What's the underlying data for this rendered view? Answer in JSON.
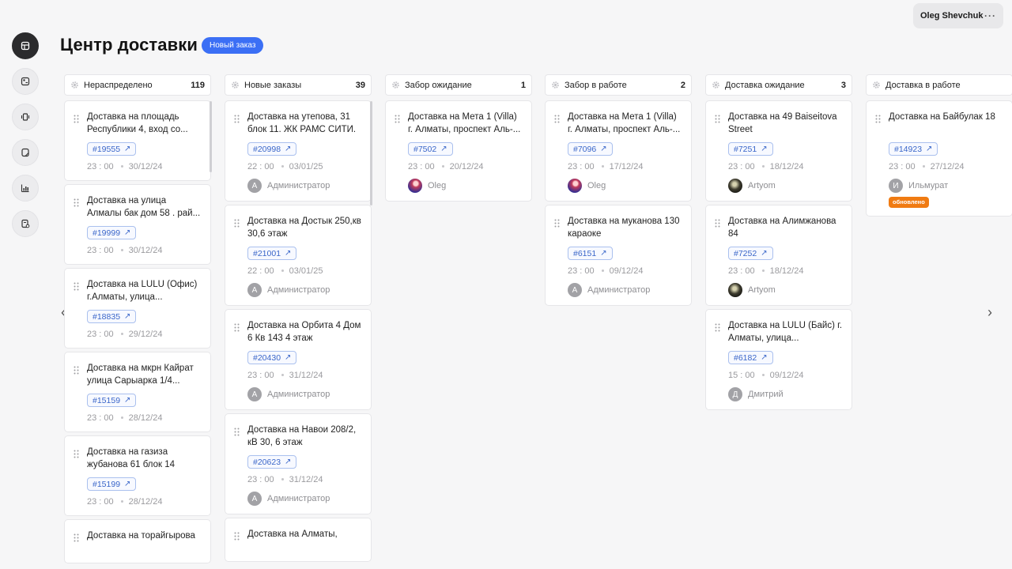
{
  "header": {
    "title": "Центр доставки",
    "new_order_label": "Новый заказ",
    "user_name": "Oleg Shevchuk",
    "user_menu": "···"
  },
  "nav": {
    "left": "‹",
    "right": "›"
  },
  "columns": [
    {
      "name": "Нераспределено",
      "count": "119",
      "cards": [
        {
          "title": "Доставка на площадь Республики 4, вход со...",
          "tag": "#19555",
          "time": "23 : 00",
          "date": "30/12/24"
        },
        {
          "title": "Доставка на улица Алмалы бак дом 58 . рай...",
          "tag": "#19999",
          "time": "23 : 00",
          "date": "30/12/24"
        },
        {
          "title": "Доставка на LULU (Офис) г.Алматы, улица...",
          "tag": "#18835",
          "time": "23 : 00",
          "date": "29/12/24"
        },
        {
          "title": "Доставка на мкрн Кайрат улица Сарыарка 1/4...",
          "tag": "#15159",
          "time": "23 : 00",
          "date": "28/12/24"
        },
        {
          "title": "Доставка на газиза жубанова 61 блок 14",
          "tag": "#15199",
          "time": "23 : 00",
          "date": "28/12/24"
        },
        {
          "title": "Доставка на торайгырова",
          "tag": "",
          "time": "",
          "date": ""
        }
      ]
    },
    {
      "name": "Новые заказы",
      "count": "39",
      "cards": [
        {
          "title": "Доставка на утепова, 31 блок 11. ЖК РАМС СИТИ. ...",
          "tag": "#20998",
          "time": "22 : 00",
          "date": "03/01/25",
          "assignee": "Администратор",
          "initial": "А"
        },
        {
          "title": "Доставка на Достык 250,кв 30,6 этаж",
          "tag": "#21001",
          "time": "22 : 00",
          "date": "03/01/25",
          "assignee": "Администратор",
          "initial": "А"
        },
        {
          "title": "Доставка на Орбита 4 Дом 6 Кв 143 4 этаж",
          "tag": "#20430",
          "time": "23 : 00",
          "date": "31/12/24",
          "assignee": "Администратор",
          "initial": "А"
        },
        {
          "title": "Доставка на Навои 208/2, кВ 30, 6 этаж",
          "tag": "#20623",
          "time": "23 : 00",
          "date": "31/12/24",
          "assignee": "Администратор",
          "initial": "А"
        },
        {
          "title": "Доставка на Алматы,",
          "tag": "",
          "time": "",
          "date": ""
        }
      ]
    },
    {
      "name": "Забор ожидание",
      "count": "1",
      "cards": [
        {
          "title": "Доставка на Мета 1 (Villa) г. Алматы, проспект Аль-...",
          "tag": "#7502",
          "time": "23 : 00",
          "date": "20/12/24",
          "assignee": "Oleg",
          "avatar": "oleg-photo"
        }
      ]
    },
    {
      "name": "Забор в работе",
      "count": "2",
      "cards": [
        {
          "title": "Доставка на Мета 1 (Villa) г. Алматы, проспект Аль-...",
          "tag": "#7096",
          "time": "23 : 00",
          "date": "17/12/24",
          "assignee": "Oleg",
          "avatar": "oleg-photo"
        },
        {
          "title": "Доставка на муканова 130 караоке",
          "tag": "#6151",
          "time": "23 : 00",
          "date": "09/12/24",
          "assignee": "Администратор",
          "initial": "А"
        }
      ]
    },
    {
      "name": "Доставка ожидание",
      "count": "3",
      "cards": [
        {
          "title": "Доставка на 49 Baiseitova Street",
          "tag": "#7251",
          "time": "23 : 00",
          "date": "18/12/24",
          "assignee": "Artyom",
          "avatar": "artyom-photo"
        },
        {
          "title": "Доставка на Алимжанова 84",
          "tag": "#7252",
          "time": "23 : 00",
          "date": "18/12/24",
          "assignee": "Artyom",
          "avatar": "artyom-photo"
        },
        {
          "title": "Доставка на LULU (Байс) г. Алматы, улица...",
          "tag": "#6182",
          "time": "15 : 00",
          "date": "09/12/24",
          "assignee": "Дмитрий",
          "initial": "Д"
        }
      ]
    },
    {
      "name": "Доставка в работе",
      "count": "",
      "cards": [
        {
          "title": "Доставка на Байбулак 18",
          "tag": "#14923",
          "time": "23 : 00",
          "date": "27/12/24",
          "assignee": "Ильмурат",
          "initial": "И",
          "badge": "обновлено"
        }
      ]
    }
  ],
  "colors": {
    "accent": "#3b6ff5",
    "tag": "#3a66c9",
    "badge": "#f07b12",
    "rail_active": "#2b2b2d"
  },
  "icons": [
    "dashboard-icon",
    "orders-icon",
    "delivery-icon",
    "documents-icon",
    "analytics-icon",
    "reports-icon",
    "gear-icon",
    "drag-handle-icon",
    "external-link-icon"
  ]
}
